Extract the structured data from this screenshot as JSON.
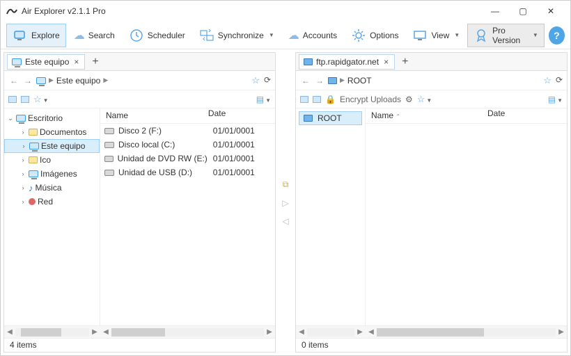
{
  "window": {
    "title": "Air Explorer v2.1.1 Pro"
  },
  "toolbar": {
    "explore": "Explore",
    "search": "Search",
    "scheduler": "Scheduler",
    "synchronize": "Synchronize",
    "accounts": "Accounts",
    "options": "Options",
    "view": "View",
    "pro": "Pro Version",
    "help": "?"
  },
  "left": {
    "tab": "Este equipo",
    "breadcrumb": [
      "Este equipo"
    ],
    "tree": {
      "root": "Escritorio",
      "children": [
        {
          "label": "Documentos",
          "icon": "folder"
        },
        {
          "label": "Este equipo",
          "icon": "pc",
          "selected": true
        },
        {
          "label": "Ico",
          "icon": "folder"
        },
        {
          "label": "Imágenes",
          "icon": "pc"
        },
        {
          "label": "Música",
          "icon": "note"
        },
        {
          "label": "Red",
          "icon": "red"
        }
      ]
    },
    "columns": {
      "name": "Name",
      "date": "Date"
    },
    "rows": [
      {
        "name": "Disco 2 (F:)",
        "date": "01/01/0001"
      },
      {
        "name": "Disco local (C:)",
        "date": "01/01/0001"
      },
      {
        "name": "Unidad de DVD RW (E:)",
        "date": "01/01/0001"
      },
      {
        "name": "Unidad de USB (D:)",
        "date": "01/01/0001"
      }
    ],
    "status": "4 items"
  },
  "right": {
    "tab": "ftp.rapidgator.net",
    "breadcrumb": [
      "ROOT"
    ],
    "encrypt": "Encrypt Uploads",
    "tree_root": "ROOT",
    "columns": {
      "name": "Name",
      "date": "Date"
    },
    "status": "0 items"
  }
}
